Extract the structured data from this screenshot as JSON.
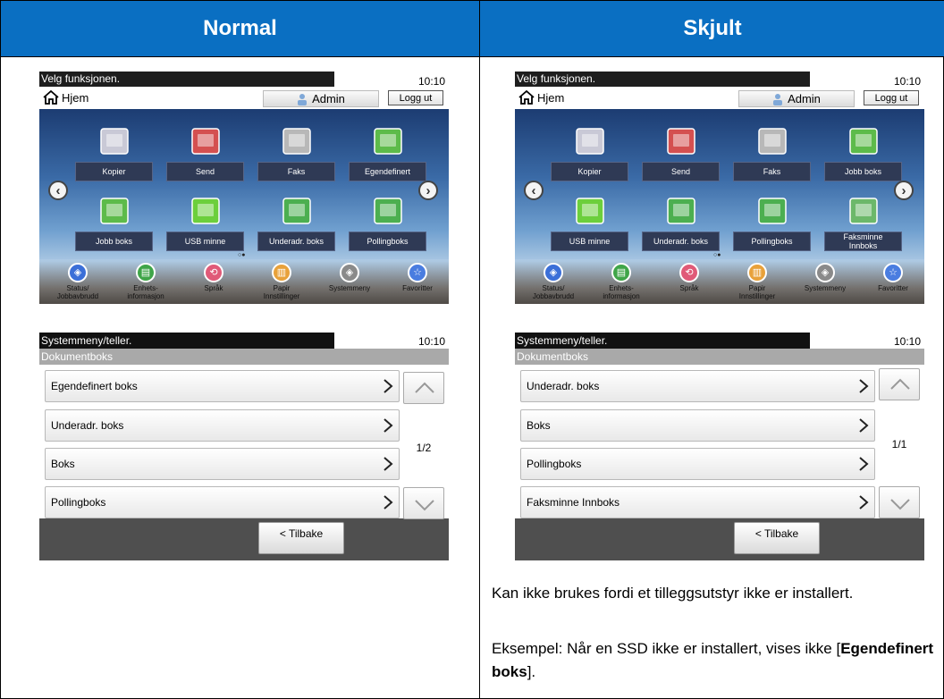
{
  "headers": {
    "left": "Normal",
    "right": "Skjult"
  },
  "home": {
    "title_text": "Velg funksjonen.",
    "time": "10:10",
    "home_label": "Hjem",
    "admin_label": "Admin",
    "logout_label": "Logg ut",
    "bottom_items": [
      "Status/\nJobbavbrudd",
      "Enhets-\ninformasjon",
      "Språk",
      "Papir\nInnstillinger",
      "Systemmeny",
      "Favoritter"
    ]
  },
  "normal_apps": [
    "Kopier",
    "Send",
    "Faks",
    "Egendefinert",
    "Jobb boks",
    "USB minne",
    "Underadr. boks",
    "Pollingboks"
  ],
  "hidden_apps": [
    "Kopier",
    "Send",
    "Faks",
    "Jobb boks",
    "USB minne",
    "Underadr. boks",
    "Pollingboks",
    "Faksminne\nInnboks"
  ],
  "sys": {
    "title_text": "Systemmeny/teller.",
    "time": "10:10",
    "crumb": "Dokumentboks",
    "back_label": "< Tilbake"
  },
  "normal_list": {
    "items": [
      "Egendefinert boks",
      "Underadr. boks",
      "Boks",
      "Pollingboks"
    ],
    "page": "1/2"
  },
  "hidden_list": {
    "items": [
      "Underadr. boks",
      "Boks",
      "Pollingboks",
      "Faksminne Innboks"
    ],
    "page": "1/1"
  },
  "note": {
    "p1": "Kan ikke brukes fordi et tilleggsutstyr ikke er installert.",
    "p2_prefix": "Eksempel: Når en SSD ikke er installert, vises ikke [",
    "p2_bold": "Egendefinert boks",
    "p2_suffix": "]."
  },
  "colors": {
    "header_bg": "#0a6fc2",
    "header_text": "#ffffff"
  }
}
